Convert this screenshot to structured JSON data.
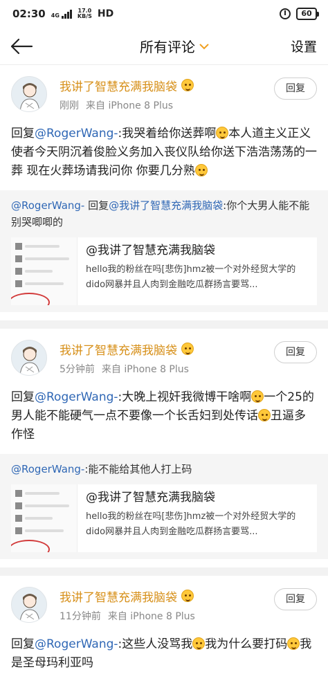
{
  "status": {
    "time": "02:30",
    "network": "4G",
    "speed_value": "17.0",
    "speed_unit": "KB/S",
    "hd": "HD",
    "battery": "60"
  },
  "nav": {
    "title": "所有评论",
    "settings": "设置"
  },
  "comments": [
    {
      "username": "我讲了智慧充满我脑袋",
      "time": "刚刚",
      "source": "来自 iPhone 8 Plus",
      "reply_label": "回复",
      "body_prefix": "回复",
      "body_mention": "@RogerWang-",
      "body_text": ":我哭着给你送葬啊",
      "body_text2": "本人道主义正义使者今天阴沉着俊脸义务加入丧仪队给你送下浩浩荡荡的一葬 现在火葬场请我问你 你要几分熟",
      "quote_mention": "@RogerWang-",
      "quote_mid": " 回复",
      "quote_mention2": "@我讲了智慧充满我脑袋",
      "quote_text": ":你个大男人能不能别哭唧唧的",
      "card_title": "@我讲了智慧充满我脑袋",
      "card_text": "hello我的粉丝在吗[悲伤]hmz被一个对外经贸大学的dido网暴并且人肉到金融吃瓜群扬言要骂..."
    },
    {
      "username": "我讲了智慧充满我脑袋",
      "time": "5分钟前",
      "source": "来自 iPhone 8 Plus",
      "reply_label": "回复",
      "body_prefix": "回复",
      "body_mention": "@RogerWang-",
      "body_text": ":大晚上视奸我微博干啥啊",
      "body_text2": "一个25的男人能不能硬气一点不要像一个长舌妇到处传话",
      "body_text3": "丑逼多作怪",
      "quote_mention": "@RogerWang-",
      "quote_text": ":能不能给其他人打上码",
      "card_title": "@我讲了智慧充满我脑袋",
      "card_text": "hello我的粉丝在吗[悲伤]hmz被一个对外经贸大学的dido网暴并且人肉到金融吃瓜群扬言要骂..."
    },
    {
      "username": "我讲了智慧充满我脑袋",
      "time": "11分钟前",
      "source": "来自 iPhone 8 Plus",
      "reply_label": "回复",
      "body_prefix": "回复",
      "body_mention": "@RogerWang-",
      "body_text": ":这些人没骂我",
      "body_text2": "我为什么要打码",
      "body_text3": "我是圣母玛利亚吗"
    }
  ],
  "colors": {
    "username": "#d7901a",
    "mention": "#2f67b5",
    "meta": "#888888",
    "quote_bg": "#f5f5f5"
  }
}
